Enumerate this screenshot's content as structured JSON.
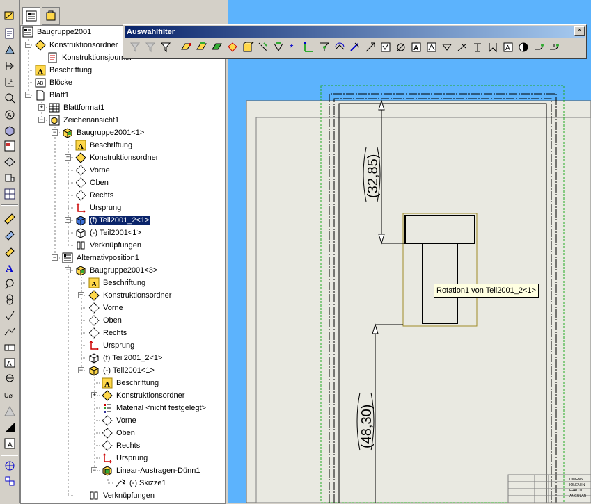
{
  "tree": {
    "root": "Baugruppe2001",
    "items": [
      {
        "label": "Konstruktionsordner",
        "icon": "folder-diamond-icon"
      },
      {
        "label": "Konstruktionsjournal",
        "icon": "journal-icon"
      },
      {
        "label": "Beschriftung",
        "icon": "annotation-icon"
      },
      {
        "label": "Blöcke",
        "icon": "blocks-icon"
      },
      {
        "label": "Blatt1",
        "icon": "sheet-icon"
      },
      {
        "label": "Blattformat1",
        "icon": "sheet-format-icon"
      },
      {
        "label": "Zeichenansicht1",
        "icon": "drawing-view-icon"
      },
      {
        "label": "Baugruppe2001<1>",
        "icon": "assembly-icon"
      },
      {
        "label": "Beschriftung",
        "icon": "annotation-icon"
      },
      {
        "label": "Konstruktionsordner",
        "icon": "folder-diamond-icon"
      },
      {
        "label": "Vorne",
        "icon": "plane-icon"
      },
      {
        "label": "Oben",
        "icon": "plane-icon"
      },
      {
        "label": "Rechts",
        "icon": "plane-icon"
      },
      {
        "label": "Ursprung",
        "icon": "origin-icon"
      },
      {
        "label": "(f) Teil2001_2<1>",
        "icon": "part-icon",
        "selected": true
      },
      {
        "label": "(-) Teil2001<1>",
        "icon": "part-icon"
      },
      {
        "label": "Verknüpfungen",
        "icon": "mates-icon"
      },
      {
        "label": "Alternativposition1",
        "icon": "alt-position-icon"
      },
      {
        "label": "Baugruppe2001<3>",
        "icon": "assembly-icon"
      },
      {
        "label": "Beschriftung",
        "icon": "annotation-icon"
      },
      {
        "label": "Konstruktionsordner",
        "icon": "folder-diamond-icon"
      },
      {
        "label": "Vorne",
        "icon": "plane-icon"
      },
      {
        "label": "Oben",
        "icon": "plane-icon"
      },
      {
        "label": "Rechts",
        "icon": "plane-icon"
      },
      {
        "label": "Ursprung",
        "icon": "origin-icon"
      },
      {
        "label": "(f) Teil2001_2<1>",
        "icon": "part-icon"
      },
      {
        "label": "(-) Teil2001<1>",
        "icon": "part-icon"
      },
      {
        "label": "Beschriftung",
        "icon": "annotation-icon"
      },
      {
        "label": "Konstruktionsordner",
        "icon": "folder-diamond-icon"
      },
      {
        "label": "Material <nicht festgelegt>",
        "icon": "material-icon"
      },
      {
        "label": "Vorne",
        "icon": "plane-icon"
      },
      {
        "label": "Oben",
        "icon": "plane-icon"
      },
      {
        "label": "Rechts",
        "icon": "plane-icon"
      },
      {
        "label": "Ursprung",
        "icon": "origin-icon"
      },
      {
        "label": "Linear-Austragen-Dünn1",
        "icon": "extrude-icon"
      },
      {
        "label": "(-) Skizze1",
        "icon": "sketch-icon"
      },
      {
        "label": "Verknüpfungen",
        "icon": "mates-icon"
      }
    ]
  },
  "filter_toolbar": {
    "title": "Auswahlfilter",
    "close": "×"
  },
  "drawing": {
    "dim_top": "(32,85)",
    "dim_bottom": "(48,30)",
    "tooltip": "Rotation1 von Teil2001_2<1>",
    "title_block": [
      "DIMENS",
      "IONEN IN",
      "FRACTI",
      "ANGULAR"
    ]
  },
  "colors": {
    "graphics_bg": "#5cb3fd",
    "sheet_bg": "#e9e9e1",
    "selection": "#0a246a",
    "highlight_box": "#a08c28"
  }
}
